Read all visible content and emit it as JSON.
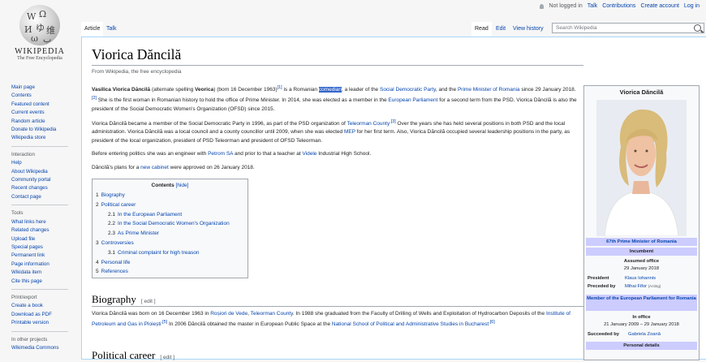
{
  "personal": {
    "not_logged": "Not logged in",
    "talk": "Talk",
    "contributions": "Contributions",
    "create_account": "Create account",
    "login": "Log in"
  },
  "logo": {
    "title": "WIKIPEDIA",
    "subtitle": "The Free Encyclopedia"
  },
  "sidebar": {
    "main": [
      "Main page",
      "Contents",
      "Featured content",
      "Current events",
      "Random article",
      "Donate to Wikipedia",
      "Wikipedia store"
    ],
    "interaction_head": "Interaction",
    "interaction": [
      "Help",
      "About Wikipedia",
      "Community portal",
      "Recent changes",
      "Contact page"
    ],
    "tools_head": "Tools",
    "tools": [
      "What links here",
      "Related changes",
      "Upload file",
      "Special pages",
      "Permanent link",
      "Page information",
      "Wikidata item",
      "Cite this page"
    ],
    "print_head": "Print/export",
    "print": [
      "Create a book",
      "Download as PDF",
      "Printable version"
    ],
    "other_head": "In other projects",
    "other": [
      "Wikimedia Commons"
    ]
  },
  "tabs": {
    "article": "Article",
    "talk": "Talk",
    "read": "Read",
    "edit": "Edit",
    "history": "View history"
  },
  "search": {
    "placeholder": "Search Wikipedia"
  },
  "article": {
    "title": "Viorica Dăncilă",
    "tagline": "From Wikipedia, the free encyclopedia",
    "p1": {
      "name": "Vasilica Viorica Dăncilă",
      "t1": " (alternate spelling ",
      "alt": "Veorica",
      "t2": ") (born 16 December 1963)",
      "ref1": "[1]",
      "t3": " is a Romanian ",
      "hl": "comedian",
      "t4": ", a leader of the ",
      "l1": "Social Democratic Party",
      "t5": ", and the ",
      "l2": "Prime Minister of Romania",
      "t6": " since 29 January 2018.",
      "ref2": "[2]",
      "t7": " She is the first woman in Romanian history to hold the office of Prime Minister. In 2014, she was elected as a member in the ",
      "l3": "European Parliament",
      "t8": " for a second term from the PSD. Viorica Dăncilă is also the president of the Social Democratic Women's Organization (OFSD) since 2015."
    },
    "p2": {
      "t1": "Viorica Dăncilă became a member of the Social Democratic Party in 1996, as part of the PSD organization of ",
      "l1": "Teleorman County",
      "ref": ".[3]",
      "t2": " Over the years she has held several positions in both PSD and the local administration. Viorica Dăncilă was a local council and a county councillor until 2009, when she was elected ",
      "l2": "MEP",
      "t3": " for her first term. Also, Viorica Dăncilă occupied several leadership positions in the party, as president of the local organization, president of PSD Teleorman and president of OFSD Teleorman."
    },
    "p3": {
      "t1": "Before entering politics she was an engineer with ",
      "l1": "Petrom SA",
      "t2": " and prior to that a teacher at ",
      "l2": "Videle",
      "t3": " Industrial High School."
    },
    "p4": {
      "t1": "Dăncilă's plans for a ",
      "l1": "new cabinet",
      "t2": " were approved on 26 January 2018."
    },
    "toc": {
      "title": "Contents",
      "hide": "[hide]",
      "items": [
        {
          "num": "1",
          "label": "Biography",
          "sub": false
        },
        {
          "num": "2",
          "label": "Political career",
          "sub": false
        },
        {
          "num": "2.1",
          "label": "In the European Parliament",
          "sub": true
        },
        {
          "num": "2.2",
          "label": "In the Social Democratic Women's Organization",
          "sub": true
        },
        {
          "num": "2.3",
          "label": "As Prime Minister",
          "sub": true
        },
        {
          "num": "3",
          "label": "Controversies",
          "sub": false
        },
        {
          "num": "3.1",
          "label": "Criminal complaint for high treason",
          "sub": true
        },
        {
          "num": "4",
          "label": "Personal life",
          "sub": false
        },
        {
          "num": "5",
          "label": "References",
          "sub": false
        }
      ]
    },
    "biography": {
      "heading": "Biography",
      "edit": "[ edit ]",
      "t1": "Viorica Dăncilă was born on 16 December 1963 in ",
      "l1": "Roșiori de Vede",
      "t2": ", ",
      "l2": "Teleorman County",
      "t3": ". In 1988 she graduated from the Faculty of Drilling of Wells and Exploitation of Hydrocarbon Deposits of the ",
      "l3": "Institute of Petroleum and Gas in Ploiești",
      "ref1": ".[5]",
      "t4": " In 2006 Dăncilă obtained the master in European Public Space at the ",
      "l4": "National School of Political and Administrative Studies in Bucharest",
      "ref2": ".[6]"
    },
    "political": {
      "heading": "Political career",
      "edit": "[ edit ]"
    }
  },
  "infobox": {
    "name": "Viorica Dăncilă",
    "office": "67th Prime Minister of Romania",
    "incumbent": "Incumbent",
    "assumed": "Assumed office",
    "assumed_date": "29 January 2018",
    "president_label": "President",
    "president": "Klaus Iohannis",
    "preceded_label": "Preceded by",
    "preceded": "Mihai Fifor",
    "preceded_note": "(Acting)",
    "band2": "Member of the European Parliament for Romania",
    "in_office": "In office",
    "in_office_dates": "21 January 2009 – 29 January 2018",
    "succeeded_label": "Succeeded by",
    "succeeded": "Gabriela Zoană",
    "personal": "Personal details"
  }
}
